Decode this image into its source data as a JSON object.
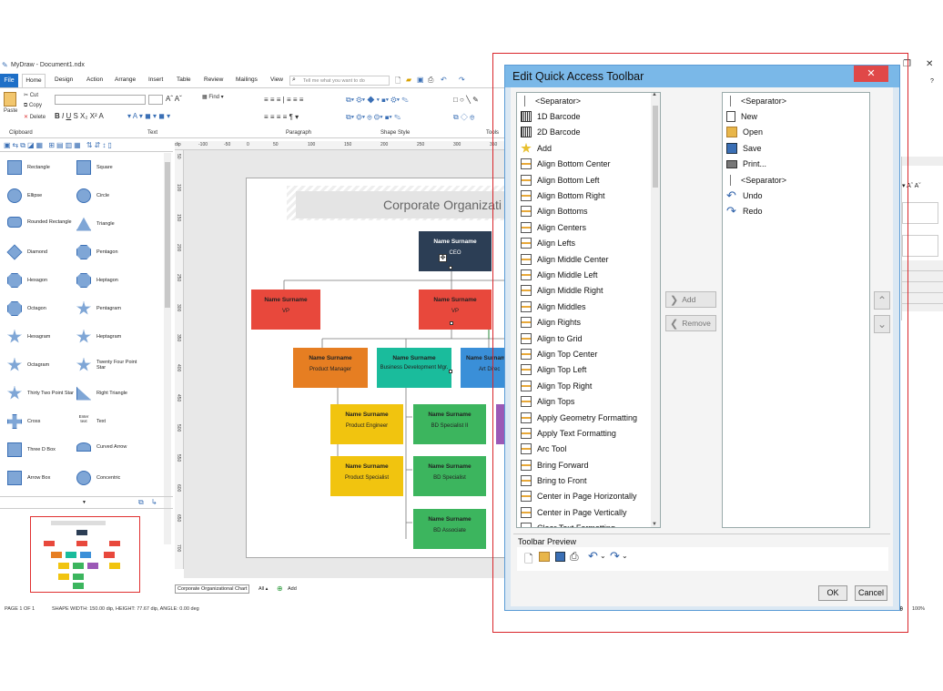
{
  "window": {
    "title": "MyDraw - Document1.ndx"
  },
  "menu": {
    "file": "File",
    "tabs": [
      "Home",
      "Design",
      "Action",
      "Arrange",
      "Insert",
      "Table",
      "Review",
      "Mailings",
      "View"
    ],
    "tellme": "Tell me what you want to do"
  },
  "ribbon": {
    "groups": [
      "Clipboard",
      "Text",
      "Paragraph",
      "Shape Style",
      "Tools"
    ],
    "clipboard": {
      "paste": "Paste",
      "cut": "Cut",
      "copy": "Copy",
      "delete": "Delete"
    },
    "find": "Find"
  },
  "shapes": [
    {
      "a": "Rectangle",
      "b": "Square"
    },
    {
      "a": "Ellipse",
      "b": "Circle"
    },
    {
      "a": "Rounded Rectangle",
      "b": "Triangle"
    },
    {
      "a": "Diamond",
      "b": "Pentagon"
    },
    {
      "a": "Hexagon",
      "b": "Heptagon"
    },
    {
      "a": "Octagon",
      "b": "Pentagram"
    },
    {
      "a": "Hexagram",
      "b": "Heptagram"
    },
    {
      "a": "Octagram",
      "b": "Twenty Four Point Star"
    },
    {
      "a": "Thirty Two Point Star",
      "b": "Right Triangle"
    },
    {
      "a": "Cross",
      "b": "Text"
    },
    {
      "a": "Three D Box",
      "b": "Curved Arrow"
    },
    {
      "a": "Arrow Box",
      "b": "Concentric"
    }
  ],
  "text_shape_sample": "Enter text",
  "ruler_top": [
    "-100",
    "-50",
    "0",
    "50",
    "100",
    "150",
    "200",
    "250",
    "300",
    "350"
  ],
  "ruler_left": [
    "50",
    "100",
    "150",
    "200",
    "250",
    "300",
    "350",
    "400",
    "450",
    "500",
    "550",
    "600",
    "650",
    "700"
  ],
  "chart": {
    "title": "Corporate Organizati",
    "nodes": [
      {
        "name": "Name Surname",
        "role": "CEO"
      },
      {
        "name": "Name Surname",
        "role": "VP"
      },
      {
        "name": "Name Surname",
        "role": "VP"
      },
      {
        "name": "Name Surname",
        "role": "Product Manager"
      },
      {
        "name": "Name Surname",
        "role": "Business Development Mgr."
      },
      {
        "name": "Name Surname",
        "role": "Art Direc"
      },
      {
        "name": "Name Surname",
        "role": "Product Engineer"
      },
      {
        "name": "Name Surname",
        "role": "BD Specialist II"
      },
      {
        "name": "Name Surname",
        "role": "Product Specialist"
      },
      {
        "name": "Name Surname",
        "role": "BD Specialist"
      },
      {
        "name": "Name Surname",
        "role": "BD Associate"
      }
    ]
  },
  "bottom": {
    "tab": "Corporate Organizational Chart",
    "all": "All",
    "add": "Add"
  },
  "status": {
    "page": "PAGE 1 OF 1",
    "shape": "SHAPE WIDTH: 150.00 dip, HEIGHT: 77.67 dip, ANGLE: 0.00 deg",
    "zoom": "100%"
  },
  "dialog": {
    "title": "Edit Quick Access Toolbar",
    "available": [
      "<Separator>",
      "1D Barcode",
      "2D Barcode",
      "Add",
      "Align Bottom Center",
      "Align Bottom Left",
      "Align Bottom Right",
      "Align Bottoms",
      "Align Centers",
      "Align Lefts",
      "Align Middle Center",
      "Align Middle Left",
      "Align Middle Right",
      "Align Middles",
      "Align Rights",
      "Align to Grid",
      "Align Top Center",
      "Align Top Left",
      "Align Top Right",
      "Align Tops",
      "Apply Geometry Formatting",
      "Apply Text Formatting",
      "Arc Tool",
      "Bring Forward",
      "Bring to Front",
      "Center in Page Horizontally",
      "Center in Page Vertically",
      "Clear Text Formatting"
    ],
    "selected": [
      "<Separator>",
      "New",
      "Open",
      "Save",
      "Print...",
      "<Separator>",
      "Undo",
      "Redo"
    ],
    "add": "Add",
    "remove": "Remove",
    "preview_label": "Toolbar Preview",
    "ok": "OK",
    "cancel": "Cancel"
  },
  "colors": {
    "ceo": "#2c3e55",
    "vp": "#e8483c",
    "pm": "#e67e22",
    "bd": "#1abc9c",
    "art": "#3a8fd8",
    "eng": "#f1c40f",
    "green": "#3cb55e",
    "purple": "#9b59b6",
    "dialog_title": "#7ab8e8",
    "highlight": "#d9252b"
  }
}
